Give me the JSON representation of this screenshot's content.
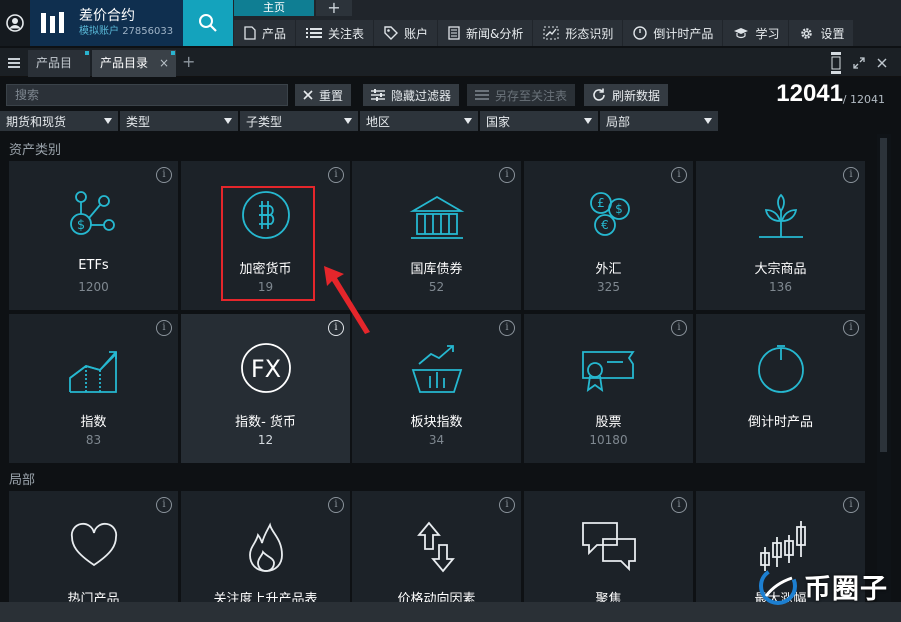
{
  "header": {
    "account_title": "差价合约",
    "account_mode": "模拟账户",
    "account_number": "27856033",
    "home_tab": "主页",
    "add_tab": "+"
  },
  "menu": {
    "items": [
      {
        "label": "产品",
        "icon": "document-icon"
      },
      {
        "label": "关注表",
        "icon": "list-icon"
      },
      {
        "label": "账户",
        "icon": "tag-icon"
      },
      {
        "label": "新闻&分析",
        "icon": "news-icon"
      },
      {
        "label": "形态识别",
        "icon": "pattern-icon"
      },
      {
        "label": "倒计时产品",
        "icon": "clock-icon"
      },
      {
        "label": "学习",
        "icon": "graduation-icon"
      },
      {
        "label": "设置",
        "icon": "gear-icon"
      }
    ]
  },
  "tabs": {
    "items": [
      {
        "label": "产品目录"
      },
      {
        "label": "产品目录",
        "close": "×"
      }
    ],
    "add": "+"
  },
  "toolbar": {
    "search_placeholder": "搜索",
    "reset_label": "重置",
    "hide_filters_label": "隐藏过滤器",
    "save_watchlist_label": "另存至关注表",
    "refresh_label": "刷新数据",
    "count": "12041",
    "total": "/ 12041"
  },
  "filters": [
    "期货和现货",
    "类型",
    "子类型",
    "地区",
    "国家",
    "局部"
  ],
  "sections": {
    "asset_classes": {
      "title": "资产类别",
      "tiles": [
        {
          "label": "ETFs",
          "count": "1200",
          "icon": "etf-network-icon"
        },
        {
          "label": "加密货币",
          "count": "19",
          "icon": "bitcoin-icon"
        },
        {
          "label": "国库债券",
          "count": "52",
          "icon": "treasury-building-icon"
        },
        {
          "label": "外汇",
          "count": "325",
          "icon": "currency-coins-icon"
        },
        {
          "label": "大宗商品",
          "count": "136",
          "icon": "plant-icon"
        },
        {
          "label": "指数",
          "count": "83",
          "icon": "index-chart-icon"
        },
        {
          "label": "指数- 货币",
          "count": "12",
          "icon": "fx-icon"
        },
        {
          "label": "板块指数",
          "count": "34",
          "icon": "basket-chart-icon"
        },
        {
          "label": "股票",
          "count": "10180",
          "icon": "certificate-icon"
        },
        {
          "label": "倒计时产品",
          "count": "",
          "icon": "stopwatch-icon"
        }
      ]
    },
    "local": {
      "title": "局部",
      "tiles": [
        {
          "label": "热门产品",
          "icon": "heart-icon"
        },
        {
          "label": "关注度上升产品表",
          "icon": "flame-icon"
        },
        {
          "label": "价格动向因素",
          "icon": "arrows-icon"
        },
        {
          "label": "聚焦",
          "icon": "speech-bubbles-icon"
        },
        {
          "label": "最大涨幅",
          "icon": "candlestick-icon"
        }
      ]
    }
  },
  "watermark": "币圈子",
  "colors": {
    "accent": "#14a3bd",
    "icon_teal": "#26b8d0",
    "highlight": "#e5262b",
    "logo_bg": "#0f2f4f"
  }
}
